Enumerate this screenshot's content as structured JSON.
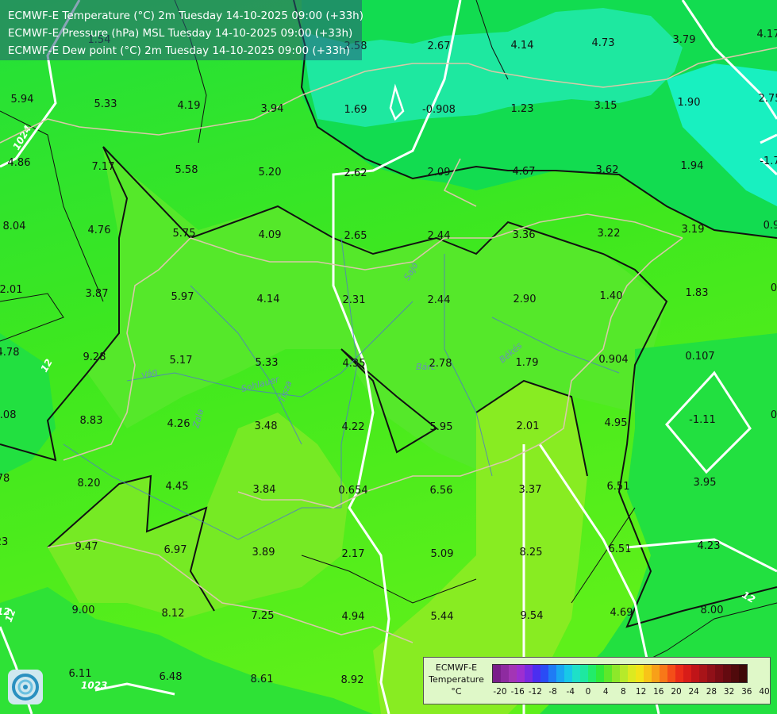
{
  "header": {
    "line1": "ECMWF-E Temperature (°C) 2m Tuesday 14-10-2025 09:00 (+33h)",
    "line2": "ECMWF-E Pressure (hPa) MSL Tuesday 14-10-2025 09:00 (+33h)",
    "line3": "ECMWF-E Dew point (°C) 2m Tuesday 14-10-2025 09:00 (+33h)"
  },
  "legend": {
    "title": "ECMWF-E",
    "subtitle": "Temperature",
    "unit": "°C",
    "ticks": [
      "-20",
      "-16",
      "-12",
      "-8",
      "-4",
      "0",
      "4",
      "8",
      "12",
      "16",
      "20",
      "24",
      "28",
      "32",
      "36",
      "40"
    ],
    "colors": [
      "#7a1f8a",
      "#8e2ba0",
      "#a335b5",
      "#9d2fd0",
      "#7a2be0",
      "#4b2ef0",
      "#2a4cf5",
      "#1f7cf5",
      "#1aa6f2",
      "#18c8e8",
      "#1ee0c8",
      "#1ee8a0",
      "#22ec6a",
      "#30ea3a",
      "#5ee82a",
      "#8de82a",
      "#b6ea2a",
      "#dcea20",
      "#f2e418",
      "#f8c418",
      "#f8a018",
      "#f87818",
      "#f44e18",
      "#ea2c18",
      "#d81c18",
      "#c01418",
      "#a81418",
      "#901018",
      "#7a0c14",
      "#640a10",
      "#500a0c",
      "#3e0808"
    ]
  },
  "isobar_labels": [
    "1024",
    "1023",
    "12",
    "12",
    "12",
    "12"
  ],
  "rivers": [
    "Vág",
    "Sohlauer",
    "Zala",
    "Tisza",
    "Sajó",
    "Marosi",
    "Bárc",
    "Barcs",
    "Békés",
    "Körös"
  ],
  "values": [
    {
      "t": "5.94"
    },
    {
      "t": "5.33"
    },
    {
      "t": "4.19"
    },
    {
      "t": "3.94"
    },
    {
      "t": "1.69"
    },
    {
      "t": "-0.908"
    },
    {
      "t": "1.23"
    },
    {
      "t": "3.15"
    },
    {
      "t": "1.90"
    },
    {
      "t": "2.75"
    },
    {
      "t": "2.58"
    },
    {
      "t": "2.67"
    },
    {
      "t": "4.14"
    },
    {
      "t": "4.73"
    },
    {
      "t": "3.79"
    },
    {
      "t": "4.17"
    },
    {
      "t": "4.86"
    },
    {
      "t": "7.17"
    },
    {
      "t": "5.58"
    },
    {
      "t": "5.20"
    },
    {
      "t": "2.62"
    },
    {
      "t": "2.09"
    },
    {
      "t": "4.67"
    },
    {
      "t": "3.62"
    },
    {
      "t": "1.94"
    },
    {
      "t": "-1.7"
    },
    {
      "t": "8.04"
    },
    {
      "t": "4.76"
    },
    {
      "t": "5.75"
    },
    {
      "t": "4.09"
    },
    {
      "t": "2.65"
    },
    {
      "t": "2.44"
    },
    {
      "t": "3.36"
    },
    {
      "t": "3.22"
    },
    {
      "t": "3.19"
    },
    {
      "t": "0.9"
    },
    {
      "t": "2.01"
    },
    {
      "t": "3.87"
    },
    {
      "t": "5.97"
    },
    {
      "t": "4.14"
    },
    {
      "t": "2.31"
    },
    {
      "t": "2.44"
    },
    {
      "t": "2.90"
    },
    {
      "t": "1.40"
    },
    {
      "t": "1.83"
    },
    {
      "t": "0"
    },
    {
      "t": "4.78"
    },
    {
      "t": "9.28"
    },
    {
      "t": "5.17"
    },
    {
      "t": "5.33"
    },
    {
      "t": "4.35"
    },
    {
      "t": "2.78"
    },
    {
      "t": "1.79"
    },
    {
      "t": "0.904"
    },
    {
      "t": "0.107"
    },
    {
      "t": "0.08"
    },
    {
      "t": "8.83"
    },
    {
      "t": "4.26"
    },
    {
      "t": "3.48"
    },
    {
      "t": "4.22"
    },
    {
      "t": "5.95"
    },
    {
      "t": "2.01"
    },
    {
      "t": "4.95"
    },
    {
      "t": "-1.11"
    },
    {
      "t": "0"
    },
    {
      "t": "78"
    },
    {
      "t": "8.20"
    },
    {
      "t": "4.45"
    },
    {
      "t": "3.84"
    },
    {
      "t": "0.654"
    },
    {
      "t": "6.56"
    },
    {
      "t": "3.37"
    },
    {
      "t": "6.51"
    },
    {
      "t": "3.95"
    },
    {
      "t": "23"
    },
    {
      "t": "9.47"
    },
    {
      "t": "6.97"
    },
    {
      "t": "3.89"
    },
    {
      "t": "2.17"
    },
    {
      "t": "5.09"
    },
    {
      "t": "8.25"
    },
    {
      "t": "6.51"
    },
    {
      "t": "4.23"
    },
    {
      "t": "9.00"
    },
    {
      "t": "8.12"
    },
    {
      "t": "7.25"
    },
    {
      "t": "4.94"
    },
    {
      "t": "5.44"
    },
    {
      "t": "9.54"
    },
    {
      "t": "4.69"
    },
    {
      "t": "8.00"
    },
    {
      "t": "6.11"
    },
    {
      "t": "6.48"
    },
    {
      "t": "8.61"
    },
    {
      "t": "8.92"
    },
    {
      "t": "1.54"
    }
  ]
}
